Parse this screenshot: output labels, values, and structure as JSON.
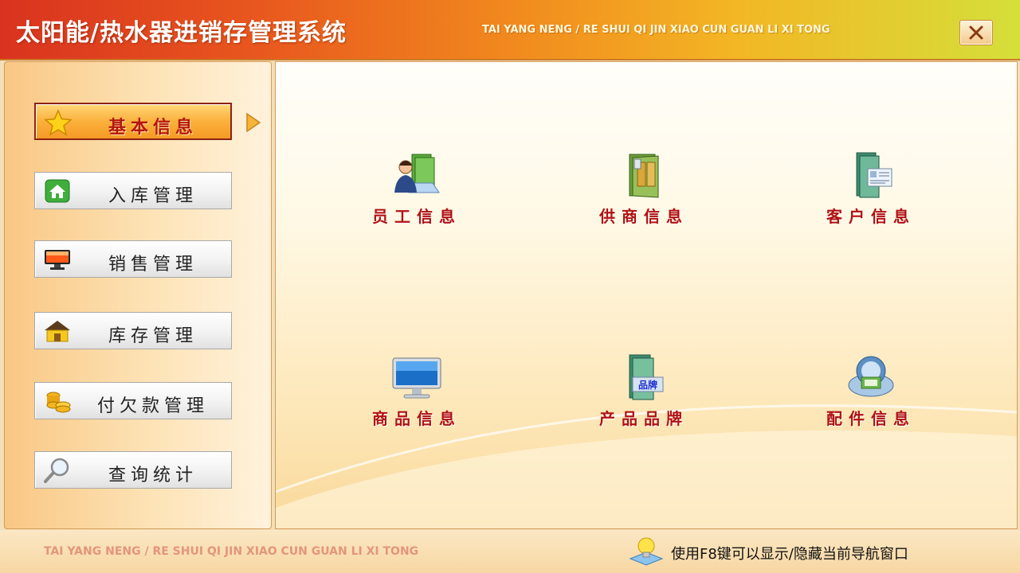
{
  "window": {
    "title": "太阳能/热水器进销存管理系统",
    "pinyin_title": "TAI YANG NENG / RE SHUI QI JIN XIAO CUN GUAN LI XI TONG"
  },
  "sidebar": {
    "items": [
      {
        "label": "基本信息",
        "icon": "star-icon",
        "active": true
      },
      {
        "label": "入库管理",
        "icon": "home-icon",
        "active": false
      },
      {
        "label": "销售管理",
        "icon": "monitor-icon",
        "active": false
      },
      {
        "label": "库存管理",
        "icon": "warehouse-icon",
        "active": false
      },
      {
        "label": "付欠款管理",
        "icon": "coins-icon",
        "active": false
      },
      {
        "label": "查询统计",
        "icon": "magnifier-icon",
        "active": false
      }
    ]
  },
  "main": {
    "tiles": [
      {
        "label": "员工信息",
        "icon": "employee-folder-icon"
      },
      {
        "label": "供商信息",
        "icon": "supplier-folder-icon"
      },
      {
        "label": "客户信息",
        "icon": "customer-folder-icon"
      },
      {
        "label": "商品信息",
        "icon": "monitor-icon"
      },
      {
        "label": "产品品牌",
        "icon": "brand-folder-icon",
        "icon_text": "品牌"
      },
      {
        "label": "配件信息",
        "icon": "parts-icon"
      }
    ]
  },
  "status": {
    "pinyin": "TAI YANG NENG / RE SHUI QI JIN XIAO CUN GUAN LI XI TONG",
    "hint": "使用F8键可以显示/隐藏当前导航窗口"
  },
  "colors": {
    "title_gradient_start": "#d9331f",
    "title_gradient_end": "#d5df3a",
    "tile_label": "#b11212",
    "active_nav": "#f7a530"
  }
}
